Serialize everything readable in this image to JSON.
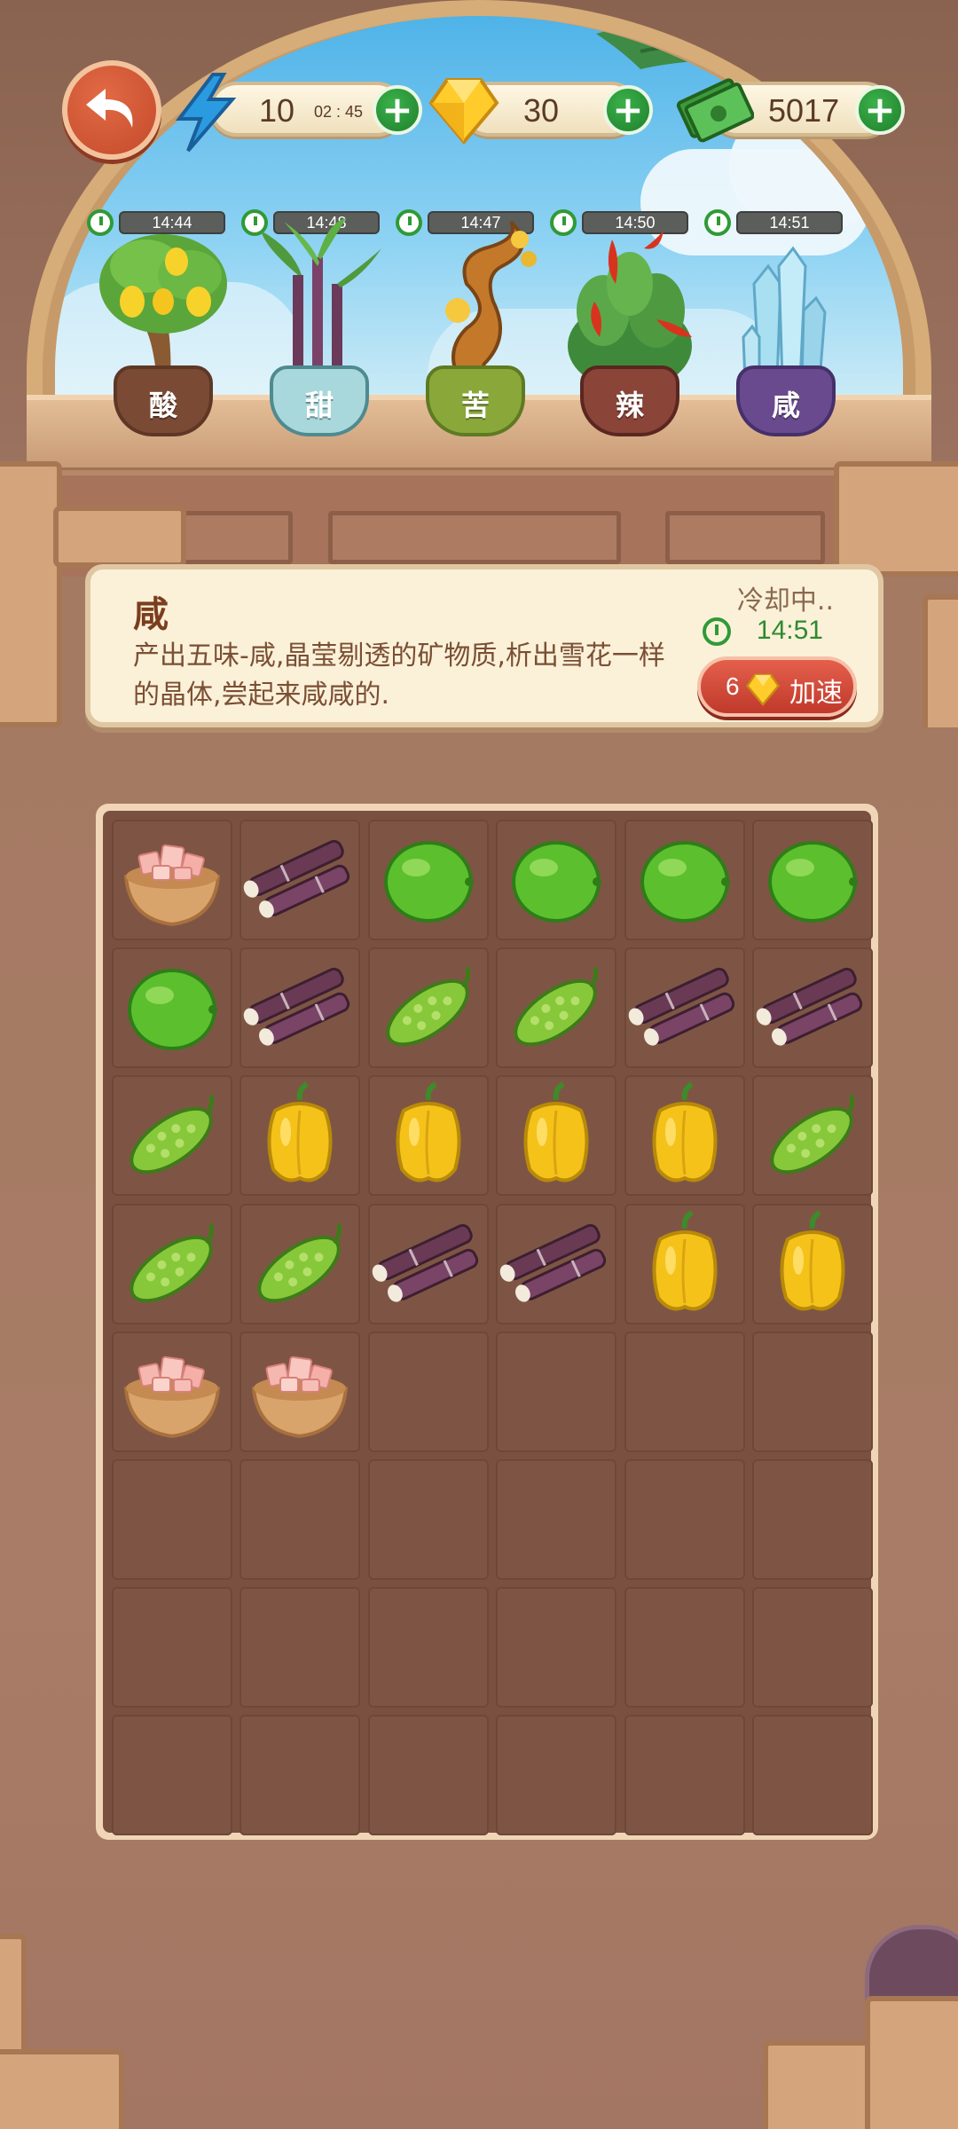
{
  "hud": {
    "energy": {
      "value": "10",
      "timer": "02 : 45"
    },
    "gems": {
      "value": "30"
    },
    "cash": {
      "value": "5017"
    }
  },
  "plants": [
    {
      "label": "酸",
      "timer": "14:44"
    },
    {
      "label": "甜",
      "timer": "14:48"
    },
    {
      "label": "苦",
      "timer": "14:47"
    },
    {
      "label": "辣",
      "timer": "14:50"
    },
    {
      "label": "咸",
      "timer": "14:51"
    }
  ],
  "info": {
    "title": "咸",
    "description": "产出五味-咸,晶莹剔透的矿物质,析出雪花一样的晶体,尝起来咸咸的.",
    "status": "冷却中..",
    "timer": "14:51",
    "speedup_cost": "6",
    "speedup_label": "加速"
  },
  "board": {
    "rows": 8,
    "cols": 6,
    "items": [
      [
        "salt",
        "sugarcane",
        "lime",
        "lime",
        "lime",
        "lime"
      ],
      [
        "lime",
        "sugarcane",
        "bittermelon",
        "bittermelon",
        "sugarcane",
        "sugarcane"
      ],
      [
        "bittermelon",
        "pepper",
        "pepper",
        "pepper",
        "pepper",
        "bittermelon"
      ],
      [
        "bittermelon",
        "bittermelon",
        "sugarcane",
        "sugarcane",
        "pepper",
        "pepper"
      ],
      [
        "salt",
        "salt",
        "",
        "",
        "",
        ""
      ],
      [
        "",
        "",
        "",
        "",
        "",
        ""
      ],
      [
        "",
        "",
        "",
        "",
        "",
        ""
      ],
      [
        "",
        "",
        "",
        "",
        "",
        ""
      ]
    ]
  },
  "colors": {
    "accent_green": "#2f9a37",
    "speed_button": "#c0392b",
    "panel_bg": "#fbf1d9"
  }
}
